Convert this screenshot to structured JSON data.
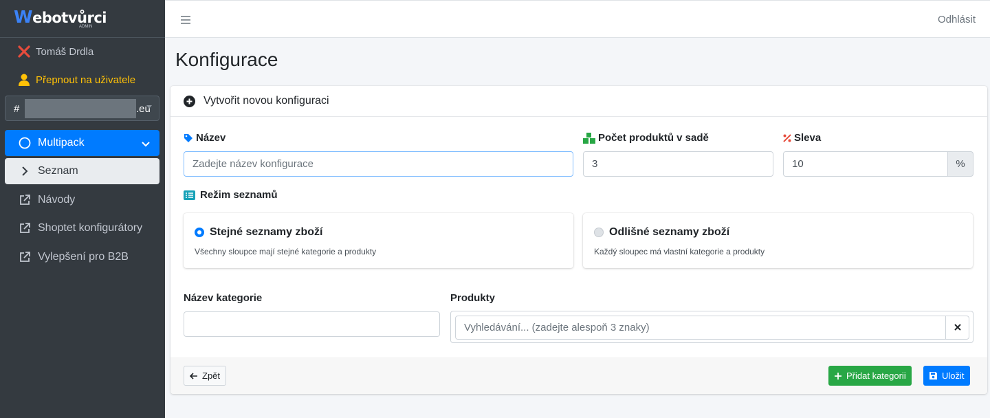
{
  "sidebar": {
    "logo_text": "ebotvůrci",
    "logo_letter": "W",
    "logo_sub": "ADMIN",
    "user_name": "Tomáš Drdla",
    "switch_user_label": "Přepnout na uživatele",
    "account": {
      "prefix": "#",
      "suffix": ".eu"
    },
    "items": [
      {
        "label": "Multipack"
      },
      {
        "label": "Seznam"
      },
      {
        "label": "Návody"
      },
      {
        "label": "Shoptet konfigurátory"
      },
      {
        "label": "Vylepšení pro B2B"
      }
    ]
  },
  "topbar": {
    "logout_label": "Odhlásit"
  },
  "page": {
    "title": "Konfigurace"
  },
  "form": {
    "header": "Vytvořit novou konfiguraci",
    "name": {
      "label": "Název",
      "placeholder": "Zadejte název konfigurace"
    },
    "count": {
      "label": "Počet produktů v sadě",
      "value": "3"
    },
    "discount": {
      "label": "Sleva",
      "value": "10",
      "unit": "%"
    },
    "list_mode": {
      "label": "Režim seznamů",
      "options": [
        {
          "title": "Stejné seznamy zboží",
          "desc": "Všechny sloupce mají stejné kategorie a produkty",
          "selected": true
        },
        {
          "title": "Odlišné seznamy zboží",
          "desc": "Každý sloupec má vlastní kategorie a produkty",
          "selected": false
        }
      ]
    },
    "category_name": {
      "label": "Název kategorie",
      "value": ""
    },
    "products": {
      "label": "Produkty",
      "placeholder": "Vyhledávání... (zadejte alespoň 3 znaky)",
      "clear": "✕"
    }
  },
  "footer": {
    "back_label": "Zpět",
    "add_category_label": "Přidat kategorii",
    "save_label": "Uložit"
  },
  "colors": {
    "primary": "#007bff",
    "success": "#28a745",
    "sidebar": "#343a40",
    "warning": "#ffc107",
    "danger": "#e74c3c"
  }
}
